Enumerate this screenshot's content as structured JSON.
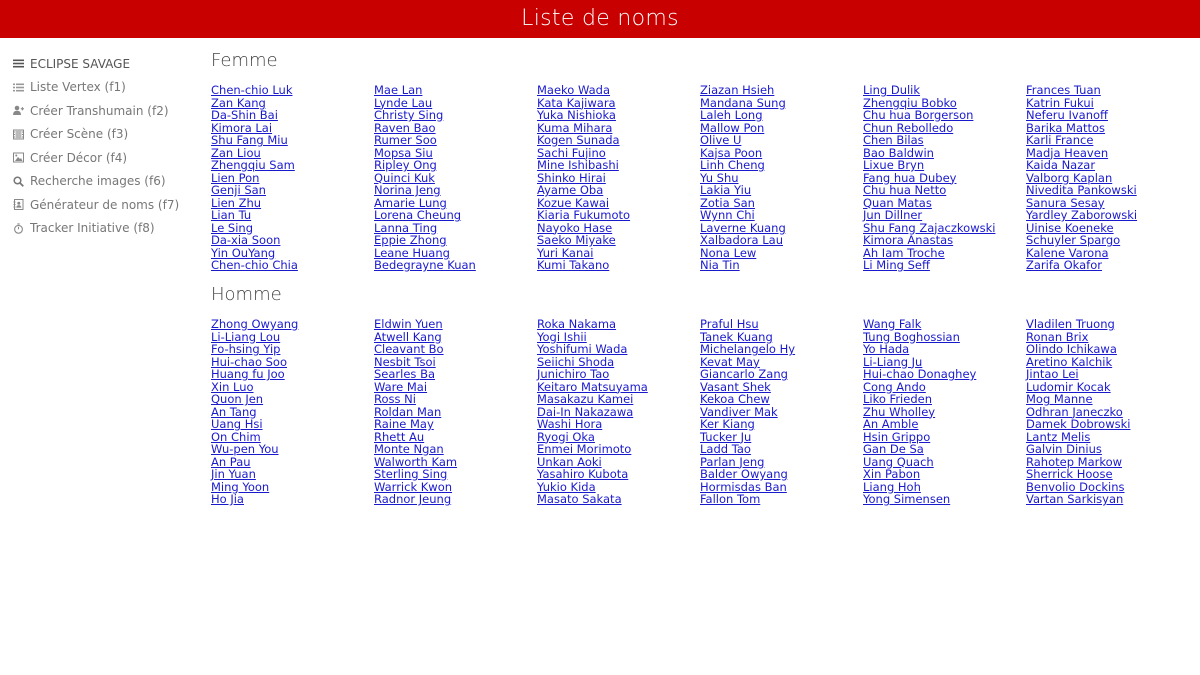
{
  "app": {
    "title": "Liste de noms"
  },
  "sidebar": {
    "brand": {
      "label": "ECLIPSE SAVAGE",
      "icon": "menu-icon"
    },
    "items": [
      {
        "label": "Liste Vertex (f1)",
        "icon": "list-icon"
      },
      {
        "label": "Créer Transhumain (f2)",
        "icon": "user-plus-icon"
      },
      {
        "label": "Créer Scène (f3)",
        "icon": "film-icon"
      },
      {
        "label": "Créer Décor (f4)",
        "icon": "image-icon"
      },
      {
        "label": "Recherche images (f6)",
        "icon": "search-icon"
      },
      {
        "label": "Générateur de noms (f7)",
        "icon": "address-book-icon"
      },
      {
        "label": "Tracker Initiative (f8)",
        "icon": "stopwatch-icon"
      }
    ]
  },
  "sections": {
    "femme": {
      "title": "Femme",
      "names": [
        "Chen-chio Luk",
        "Zan Kang",
        "Da-Shin Bai",
        "Kimora Lai",
        "Shu Fang Miu",
        "Zan Liou",
        "Zhengqiu Sam",
        "Lien Pon",
        "Genji San",
        "Lien Zhu",
        "Lian Tu",
        "Le Sing",
        "Da-xia Soon",
        "Yin OuYang",
        "Chen-chio Chia",
        "Mae Lan",
        "Lynde Lau",
        "Christy Sing",
        "Raven Bao",
        "Rumer Soo",
        "Mopsa Siu",
        "Ripley Ong",
        "Quinci Kuk",
        "Norina Jeng",
        "Amarie Lung",
        "Lorena Cheung",
        "Lanna Ting",
        "Eppie Zhong",
        "Leane Huang",
        "Bedegrayne Kuan",
        "Maeko Wada",
        "Kata Kajiwara",
        "Yuka Nishioka",
        "Kuma Mihara",
        "Kogen Sunada",
        "Sachi Fujino",
        "Mine Ishibashi",
        "Shinko Hirai",
        "Ayame Oba",
        "Kozue Kawai",
        "Kiaria Fukumoto",
        "Nayoko Hase",
        "Saeko Miyake",
        "Yuri Kanai",
        "Kumi Takano",
        "Ziazan Hsieh",
        "Mandana Sung",
        "Laleh Long",
        "Mallow Pon",
        "Olive U",
        "Kajsa Poon",
        "Linh Cheng",
        "Yu Shu",
        "Lakia Yiu",
        "Zotia San",
        "Wynn Chi",
        "Laverne Kuang",
        "Xalbadora Lau",
        "Nona Lew",
        "Nia Tin",
        "Ling Dulik",
        "Zhengqiu Bobko",
        "Chu hua Borgerson",
        "Chun Rebolledo",
        "Chen Bilas",
        "Bao Baldwin",
        "Lixue Bryn",
        "Fang hua Dubey",
        "Chu hua Netto",
        "Quan Matas",
        "Jun Dillner",
        "Shu Fang Zajaczkowski",
        "Kimora Anastas",
        "Ah Iam Troche",
        "Li Ming Seff",
        "Frances Tuan",
        "Katrin Fukui",
        "Neferu Ivanoff",
        "Barika Mattos",
        "Karli France",
        "Madja Heaven",
        "Kaida Nazar",
        "Valborg Kaplan",
        "Nivedita Pankowski",
        "Sanura Sesay",
        "Yardley Zaborowski",
        "Uinise Koeneke",
        "Schuyler Spargo",
        "Kalene Varona",
        "Zarifa Okafor"
      ]
    },
    "homme": {
      "title": "Homme",
      "names": [
        "Zhong Owyang",
        "Li-Liang Lou",
        "Fo-hsing Yip",
        "Hui-chao Soo",
        "Huang fu Joo",
        "Xin Luo",
        "Quon Jen",
        "An Tang",
        "Uang Hsi",
        "On Chim",
        "Wu-pen You",
        "An Pau",
        "Jin Yuan",
        "Ming Yoon",
        "Ho Jia",
        "Eldwin Yuen",
        "Atwell Kang",
        "Cleavant Bo",
        "Nesbit Tsoi",
        "Searles Ba",
        "Ware Mai",
        "Ross Ni",
        "Roldan Man",
        "Raine May",
        "Rhett Au",
        "Monte Ngan",
        "Walworth Kam",
        "Sterling Sing",
        "Warrick Kwon",
        "Radnor Jeung",
        "Roka Nakama",
        "Yogi Ishii",
        "Yoshifumi Wada",
        "Seiichi Shoda",
        "Junichiro Tao",
        "Keitaro Matsuyama",
        "Masakazu Kamei",
        "Dai-In Nakazawa",
        "Washi Hora",
        "Ryogi Oka",
        "Enmei Morimoto",
        "Unkan Aoki",
        "Yasahiro Kubota",
        "Yukio Kida",
        "Masato Sakata",
        "Praful Hsu",
        "Tanek Kuang",
        "Michelangelo Hy",
        "Kevat May",
        "Giancarlo Zang",
        "Vasant Shek",
        "Kekoa Chew",
        "Vandiver Mak",
        "Ker Kiang",
        "Tucker Ju",
        "Ladd Tao",
        "Parlan Jeng",
        "Balder Owyang",
        "Hormisdas Ban",
        "Fallon Tom",
        "Wang Falk",
        "Tung Boghossian",
        "Yo Hada",
        "Li-Liang Ju",
        "Hui-chao Donaghey",
        "Cong Ando",
        "Liko Frieden",
        "Zhu Wholley",
        "An Amble",
        "Hsin Grippo",
        "Gan De Sa",
        "Uang Quach",
        "Xin Pabon",
        "Liang Hoh",
        "Yong Simensen",
        "Vladilen Truong",
        "Ronan Brix",
        "Olindo Ichikawa",
        "Aretino Kalchik",
        "Jintao Lei",
        "Ludomir Kocak",
        "Mog Manne",
        "Odhran Janeczko",
        "Damek Dobrowski",
        "Lantz Melis",
        "Galvin Dinius",
        "Rahotep Markow",
        "Sherrick Hoose",
        "Benvolio Dockins",
        "Vartan Sarkisyan"
      ]
    }
  },
  "colors": {
    "topbar": "#c80000",
    "link": "#1a1acd"
  }
}
